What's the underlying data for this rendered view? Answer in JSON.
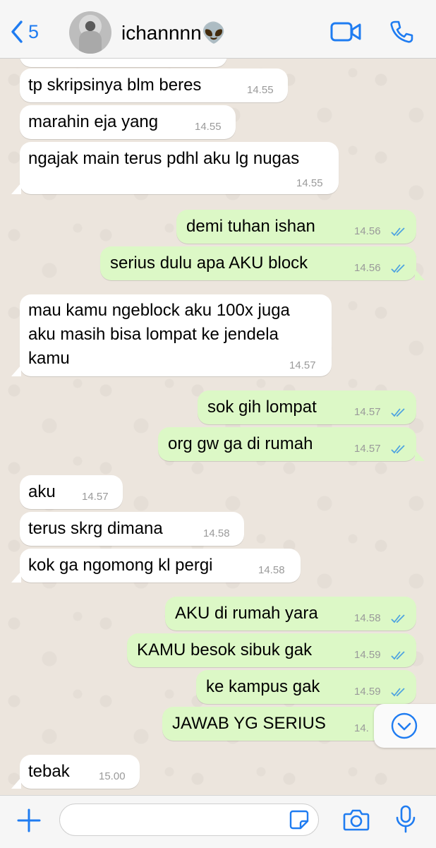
{
  "header": {
    "back_count": "5",
    "contact_name": "ichannnn👽"
  },
  "messages": [
    {
      "dir": "in",
      "lines": [
        "tp skripsinya blm beres"
      ],
      "time": "14.55"
    },
    {
      "dir": "in",
      "lines": [
        "marahin eja yang"
      ],
      "time": "14.55"
    },
    {
      "dir": "in",
      "lines": [
        "ngajak main terus pdhl aku lg nugas"
      ],
      "time": "14.55"
    },
    {
      "dir": "out",
      "lines": [
        "demi tuhan ishan"
      ],
      "time": "14.56"
    },
    {
      "dir": "out",
      "lines": [
        "serius dulu apa AKU block"
      ],
      "time": "14.56"
    },
    {
      "dir": "in",
      "lines": [
        "mau kamu ngeblock aku 100x juga",
        "aku masih bisa lompat ke jendela",
        "kamu"
      ],
      "time": "14.57"
    },
    {
      "dir": "out",
      "lines": [
        "sok gih lompat"
      ],
      "time": "14.57"
    },
    {
      "dir": "out",
      "lines": [
        "org gw ga di rumah"
      ],
      "time": "14.57"
    },
    {
      "dir": "in",
      "lines": [
        "aku"
      ],
      "time": "14.57"
    },
    {
      "dir": "in",
      "lines": [
        "terus skrg dimana"
      ],
      "time": "14.58"
    },
    {
      "dir": "in",
      "lines": [
        "kok ga ngomong kl pergi"
      ],
      "time": "14.58"
    },
    {
      "dir": "out",
      "lines": [
        "AKU di rumah yara"
      ],
      "time": "14.58"
    },
    {
      "dir": "out",
      "lines": [
        "KAMU besok sibuk gak"
      ],
      "time": "14.59"
    },
    {
      "dir": "out",
      "lines": [
        "ke kampus gak"
      ],
      "time": "14.59"
    },
    {
      "dir": "out",
      "lines": [
        "JAWAB YG SERIUS"
      ],
      "time": "14."
    },
    {
      "dir": "in",
      "lines": [
        "tebak"
      ],
      "time": "15.00"
    }
  ],
  "input": {
    "placeholder": "",
    "value": ""
  },
  "colors": {
    "accent": "#1f7cf1",
    "incoming_bubble": "#ffffff",
    "outgoing_bubble": "#dcf8c6",
    "read_ticks": "#4fa3e0"
  },
  "icons": [
    "chevron-left-icon",
    "video-icon",
    "phone-icon",
    "chevron-down-icon",
    "plus-icon",
    "sticker-icon",
    "camera-icon",
    "microphone-icon"
  ]
}
